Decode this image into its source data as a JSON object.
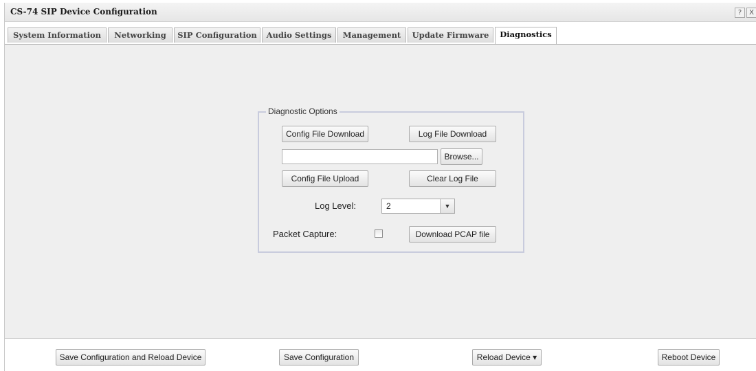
{
  "window": {
    "title": "CS-74 SIP Device Configuration",
    "help_icon": "?",
    "close_icon": "X"
  },
  "tabs": [
    {
      "label": "System Information"
    },
    {
      "label": "Networking"
    },
    {
      "label": "SIP Configuration"
    },
    {
      "label": "Audio Settings"
    },
    {
      "label": "Management"
    },
    {
      "label": "Update Firmware"
    },
    {
      "label": "Diagnostics",
      "active": true
    }
  ],
  "diagnostics": {
    "legend": "Diagnostic Options",
    "config_download_label": "Config File Download",
    "log_download_label": "Log File Download",
    "file_input_value": "",
    "browse_label": "Browse...",
    "config_upload_label": "Config File Upload",
    "clear_log_label": "Clear Log File",
    "log_level_label": "Log Level:",
    "log_level_value": "2",
    "packet_capture_label": "Packet Capture:",
    "packet_capture_checked": false,
    "download_pcap_label": "Download PCAP file"
  },
  "footer": {
    "save_reload_label": "Save Configuration and Reload Device",
    "save_label": "Save Configuration",
    "reload_label": "Reload Device ▾",
    "reboot_label": "Reboot Device"
  },
  "icons": {
    "select_arrow": "chevron-down-icon",
    "help": "help-icon",
    "close": "close-icon"
  }
}
